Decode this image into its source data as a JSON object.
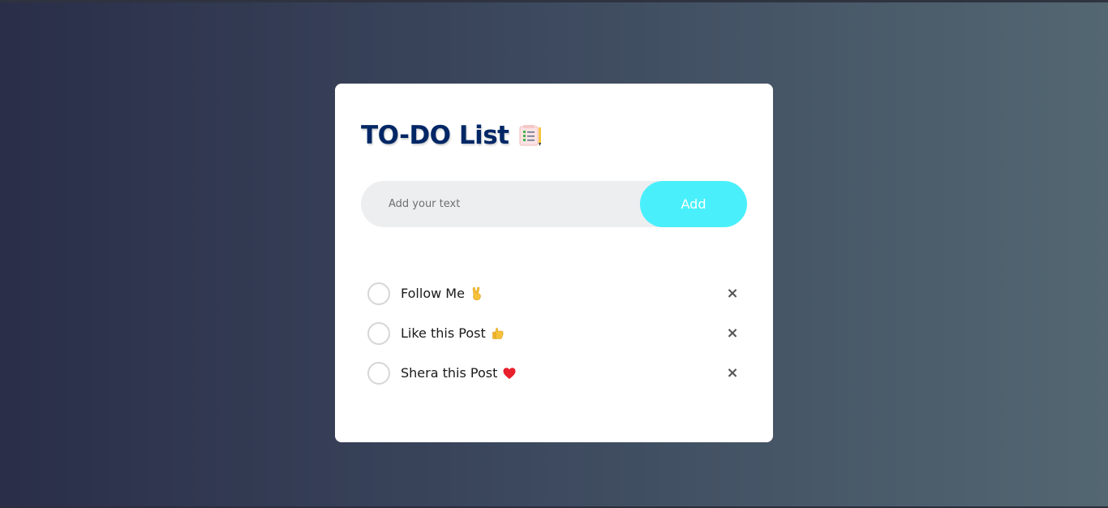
{
  "app": {
    "title": "TO-DO List",
    "title_icon": "notepad-checklist-icon",
    "accent_color": "#49f0fb",
    "title_color": "#002765"
  },
  "input": {
    "value": "",
    "placeholder": "Add your text",
    "add_label": "Add"
  },
  "todos": [
    {
      "text": "Follow Me",
      "emoji": "victory-hand-icon",
      "checked": false,
      "delete_label": "×"
    },
    {
      "text": "Like this Post",
      "emoji": "thumbs-up-icon",
      "checked": false,
      "delete_label": "×"
    },
    {
      "text": "Shera this Post",
      "emoji": "red-heart-icon",
      "checked": false,
      "delete_label": "×"
    }
  ]
}
